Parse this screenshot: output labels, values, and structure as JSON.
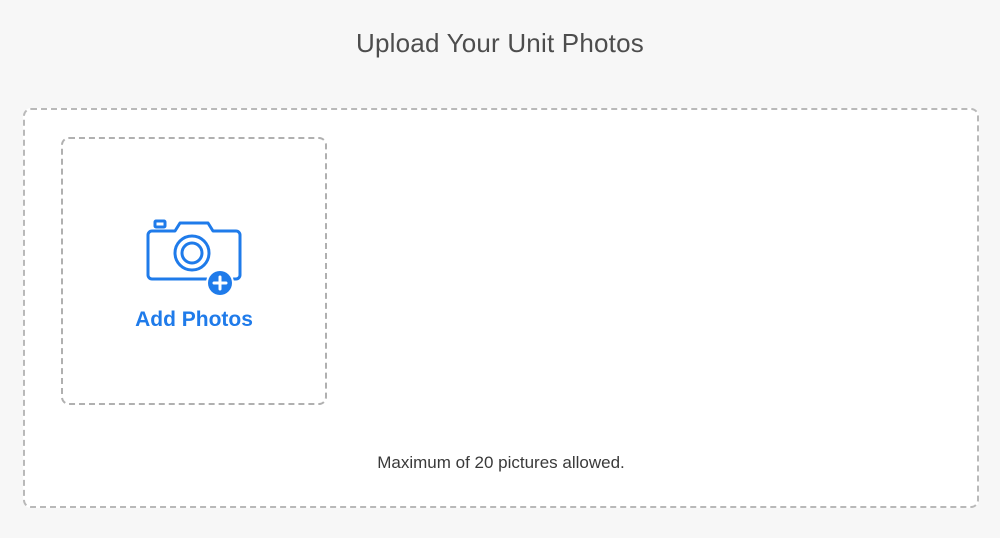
{
  "page": {
    "title": "Upload Your Unit Photos"
  },
  "upload": {
    "add_label": "Add Photos",
    "limit_note": "Maximum of 20 pictures allowed.",
    "icon": "camera-add-icon"
  },
  "colors": {
    "accent": "#1f7bea",
    "background": "#f7f7f7",
    "border": "#b9b9b9"
  }
}
